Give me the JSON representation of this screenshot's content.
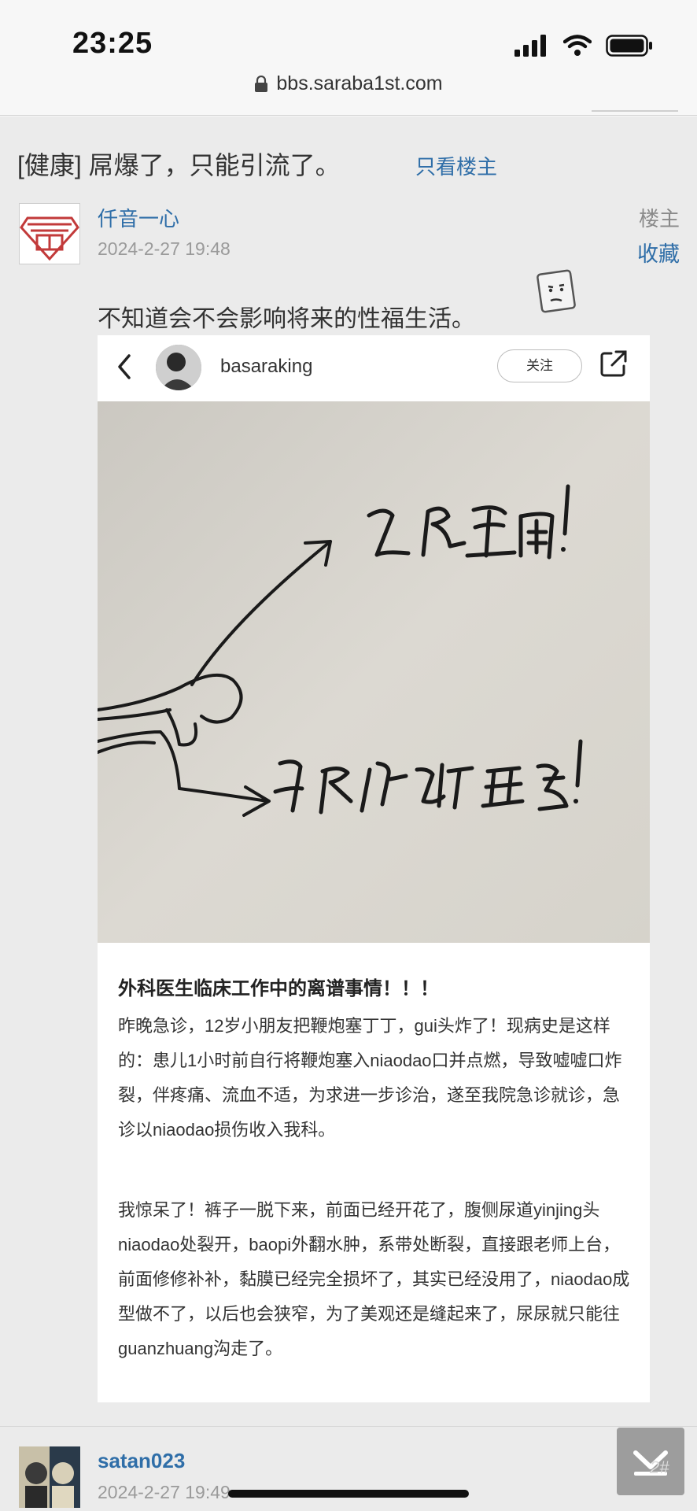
{
  "status_bar": {
    "time": "23:25"
  },
  "browser": {
    "url": "bbs.saraba1st.com"
  },
  "thread": {
    "title": "[健康] 屌爆了，只能引流了。",
    "only_op_link": "只看楼主"
  },
  "post1": {
    "author": "仟音一心",
    "date": "2024-2-27 19:48",
    "floor_label": "楼主",
    "favorite_link": "收藏",
    "text": "不知道会不会影响将来的性福生活。"
  },
  "embedded_post": {
    "username": "basaraking",
    "follow_label": "关注",
    "handwriting_top": "飞溅而出！",
    "handwriting_bottom": "尿从管道里走！",
    "title": "外科医生临床工作中的离谱事情！！！",
    "paragraphs": [
      "昨晚急诊，12岁小朋友把鞭炮塞丁丁，gui头炸了！现病史是这样的：患儿1小时前自行将鞭炮塞入niaodao口并点燃，导致嘘嘘口炸裂，伴疼痛、流血不适，为求进一步诊治，遂至我院急诊就诊，急诊以niaodao损伤收入我科。",
      "我惊呆了！裤子一脱下来，前面已经开花了，腹侧尿道yinjing头niaodao处裂开，baopi外翻水肿，系带处断裂，直接跟老师上台，前面修修补补，黏膜已经完全损坏了，其实已经没用了，niaodao成型做不了，以后也会狭窄，为了美观还是缝起来了，尿尿就只能往guanzhuang沟走了。"
    ]
  },
  "post2": {
    "author": "satan023",
    "date": "2024-2-27 19:49",
    "floor": "2#"
  }
}
